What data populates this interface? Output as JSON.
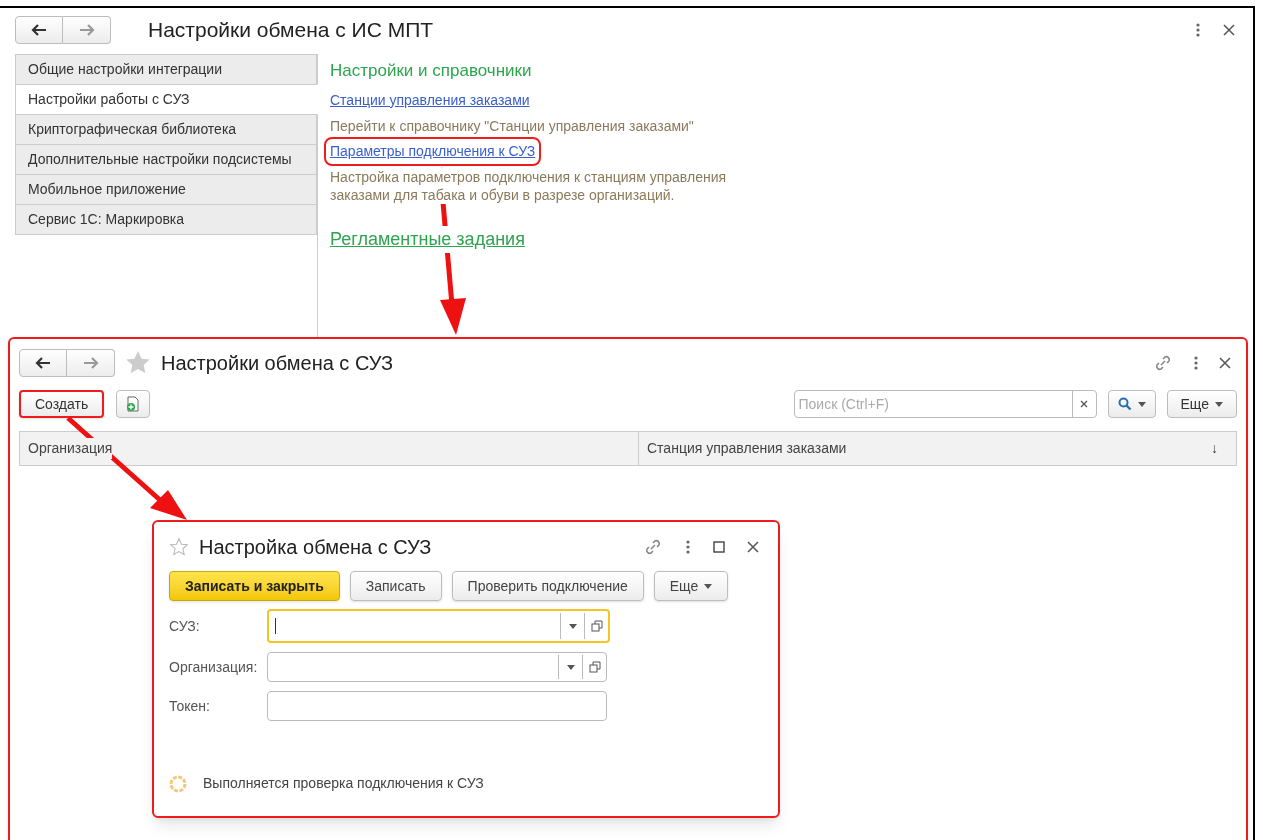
{
  "main_window": {
    "title": "Настройки обмена с ИС МПТ",
    "sections": [
      {
        "label": "Общие настройки интеграции",
        "selected": false
      },
      {
        "label": "Настройки работы с СУЗ",
        "selected": true
      },
      {
        "label": "Криптографическая библиотека",
        "selected": false
      },
      {
        "label": "Дополнительные настройки подсистемы",
        "selected": false
      },
      {
        "label": "Мобильное приложение",
        "selected": false
      },
      {
        "label": "Сервис 1С: Маркировка",
        "selected": false
      }
    ],
    "heading": "Настройки и справочники",
    "links": [
      {
        "label": "Станции управления заказами",
        "description": "Перейти к справочнику \"Станции управления заказами\"",
        "highlighted": false
      },
      {
        "label": "Параметры подключения к СУЗ",
        "description": "Настройка параметров подключения к станциям управления заказами для табака и обуви в разрезе организаций.",
        "highlighted": true
      }
    ],
    "section_link": "Регламентные задания"
  },
  "list_window": {
    "title": "Настройки обмена с СУЗ",
    "create_button": {
      "label": "Создать",
      "highlighted": true
    },
    "search": {
      "placeholder": "Поиск (Ctrl+F)"
    },
    "more_button": "Еще",
    "columns": [
      {
        "label": "Организация"
      },
      {
        "label": "Станция управления заказами",
        "sort_indicator": "↓"
      }
    ]
  },
  "form_window": {
    "title": "Настройка обмена с СУЗ",
    "buttons": [
      {
        "label": "Записать и закрыть",
        "kind": "primary"
      },
      {
        "label": "Записать",
        "kind": "default"
      },
      {
        "label": "Проверить подключение",
        "kind": "default"
      },
      {
        "label": "Еще",
        "kind": "menu"
      }
    ],
    "fields": [
      {
        "label": "СУЗ:",
        "kind": "select",
        "focused": true
      },
      {
        "label": "Организация:",
        "kind": "select",
        "focused": false
      },
      {
        "label": "Токен:",
        "kind": "text",
        "focused": false
      }
    ],
    "status": "Выполняется проверка подключения к СУЗ"
  }
}
